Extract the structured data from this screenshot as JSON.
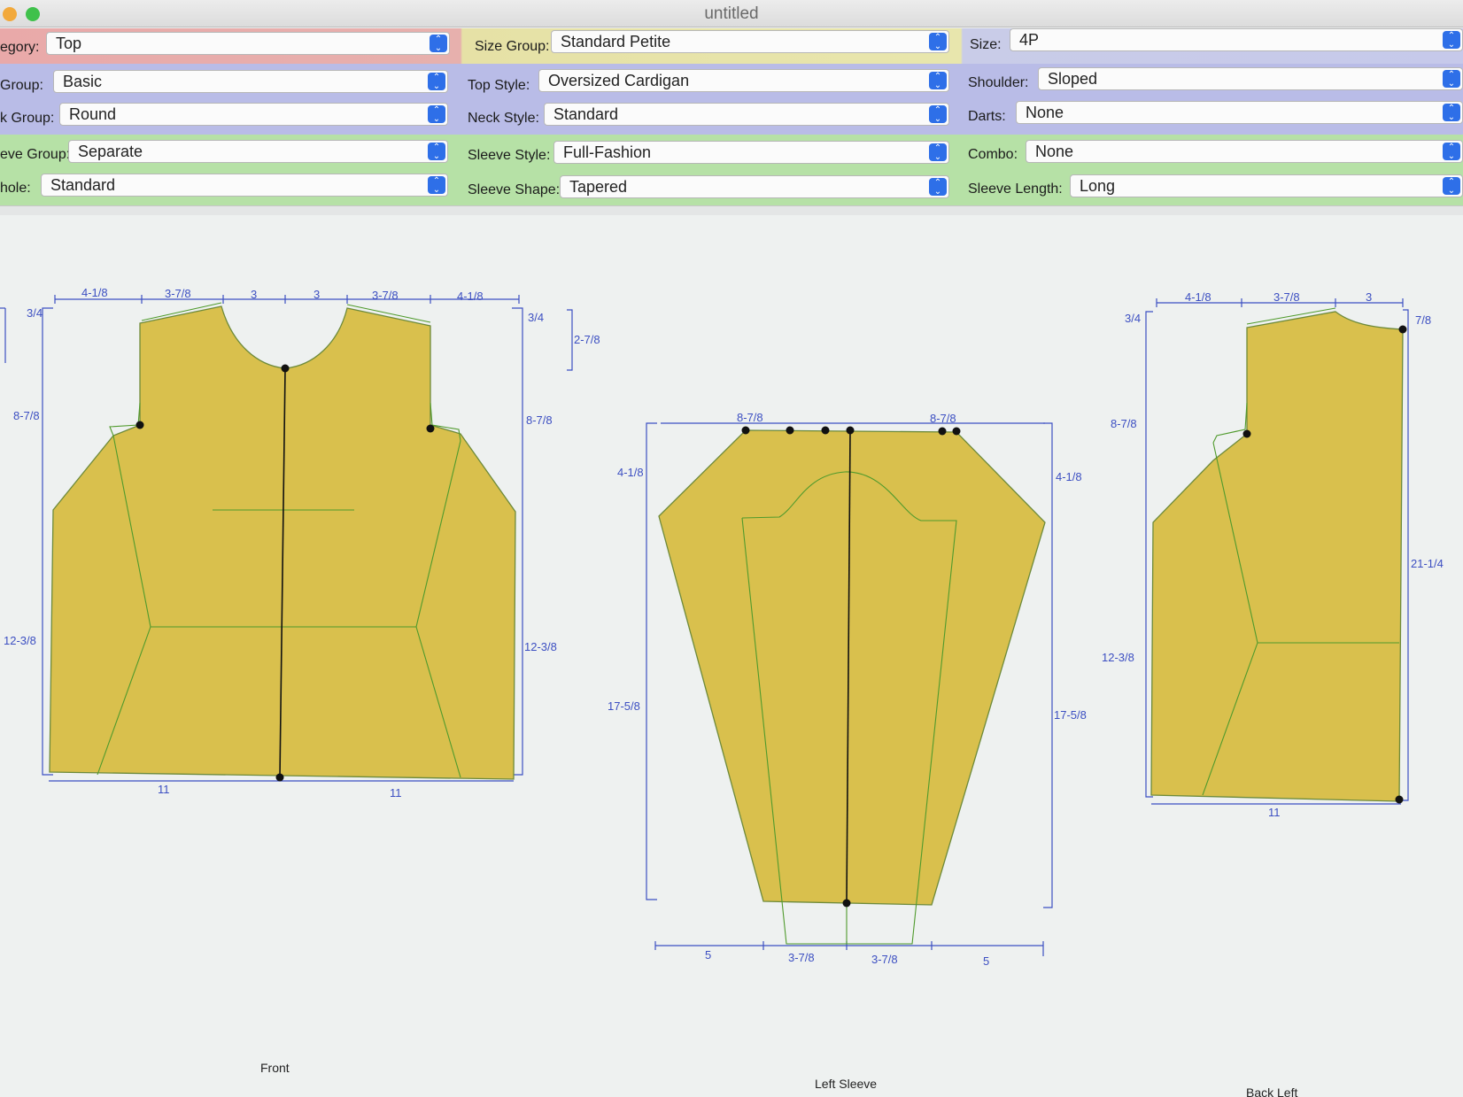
{
  "window": {
    "title": "untitled"
  },
  "controls": {
    "category": {
      "label": "egory:",
      "value": "Top"
    },
    "size_group": {
      "label": "Size Group:",
      "value": "Standard Petite"
    },
    "size": {
      "label": "Size:",
      "value": "4P"
    },
    "group": {
      "label": "Group:",
      "value": "Basic"
    },
    "top_style": {
      "label": "Top Style:",
      "value": "Oversized Cardigan"
    },
    "shoulder": {
      "label": "Shoulder:",
      "value": "Sloped"
    },
    "neck_group": {
      "label": "k Group:",
      "value": "Round"
    },
    "neck_style": {
      "label": "Neck Style:",
      "value": "Standard"
    },
    "darts": {
      "label": "Darts:",
      "value": "None"
    },
    "sleeve_group": {
      "label": "eve Group:",
      "value": "Separate"
    },
    "sleeve_style": {
      "label": "Sleeve Style:",
      "value": "Full-Fashion"
    },
    "combo": {
      "label": "Combo:",
      "value": "None"
    },
    "armhole": {
      "label": "hole:",
      "value": "Standard"
    },
    "sleeve_shape": {
      "label": "Sleeve Shape:",
      "value": "Tapered"
    },
    "sleeve_length": {
      "label": "Sleeve Length:",
      "value": "Long"
    }
  },
  "pieces": {
    "front": {
      "caption": "Front",
      "dims": {
        "top_1": "4-1/8",
        "top_2": "3-7/8",
        "top_3": "3",
        "top_4": "3",
        "top_5": "3-7/8",
        "top_6": "4-1/8",
        "left_shoulder": "3/4",
        "right_shoulder": "3/4",
        "neck_depth": "2-7/8",
        "left_armhole": "8-7/8",
        "right_armhole": "8-7/8",
        "left_side": "12-3/8",
        "right_side": "12-3/8",
        "bottom_left": "11",
        "bottom_right": "11"
      }
    },
    "left_sleeve": {
      "caption": "Left Sleeve",
      "dims": {
        "cap_left": "8-7/8",
        "cap_right": "8-7/8",
        "cap_height_left": "4-1/8",
        "cap_height_right": "4-1/8",
        "length_left": "17-5/8",
        "length_right": "17-5/8",
        "bottom_1": "5",
        "bottom_2": "3-7/8",
        "bottom_3": "3-7/8",
        "bottom_4": "5"
      }
    },
    "back_left": {
      "caption": "Back Left",
      "dims": {
        "top_1": "4-1/8",
        "top_2": "3-7/8",
        "top_3": "3",
        "shoulder": "3/4",
        "neck": "7/8",
        "armhole": "8-7/8",
        "side": "12-3/8",
        "length": "21-1/4",
        "bottom": "11"
      }
    }
  },
  "colors": {
    "piece_fill": "#d9c04d",
    "piece_stroke": "#6d8a3a",
    "dimension": "#3c4fc2",
    "guide": "#4f9a2c"
  }
}
